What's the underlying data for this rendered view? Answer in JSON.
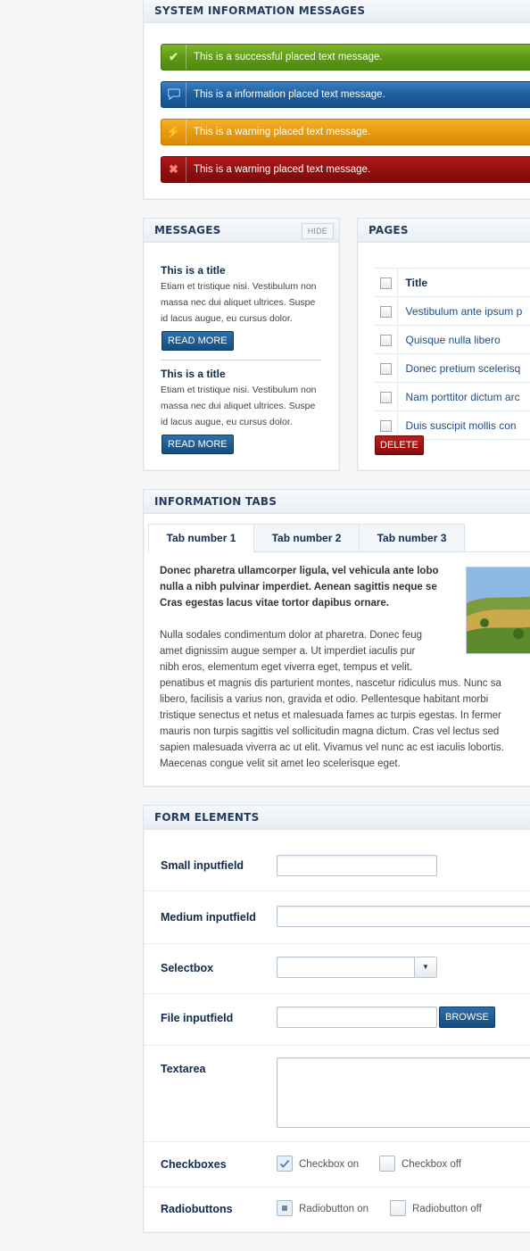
{
  "system_messages": {
    "title": "SYSTEM INFORMATION MESSAGES",
    "items": [
      {
        "type": "success",
        "icon": "check-icon",
        "text": "This is a successful placed text message."
      },
      {
        "type": "info",
        "icon": "speech-bubble-icon",
        "text": "This is a information placed text message."
      },
      {
        "type": "warning",
        "icon": "lightning-icon",
        "text": "This is a warning placed text message."
      },
      {
        "type": "error",
        "icon": "cross-icon",
        "text": "This is a warning placed text message."
      }
    ]
  },
  "messages": {
    "title": "MESSAGES",
    "hide_label": "HIDE",
    "articles": [
      {
        "title": "This is a title",
        "body": "Etiam et tristique nisi. Vestibulum non massa nec dui aliquet ultrices. Suspe id lacus augue, eu cursus dolor.",
        "button": "READ MORE"
      },
      {
        "title": "This is a title",
        "body": "Etiam et tristique nisi. Vestibulum non massa nec dui aliquet ultrices. Suspe id lacus augue, eu cursus dolor.",
        "button": "READ MORE"
      }
    ]
  },
  "pages": {
    "title": "PAGES",
    "column_header": "Title",
    "rows": [
      "Vestibulum ante ipsum p",
      "Quisque nulla libero",
      "Donec pretium scelerisq",
      "Nam porttitor dictum arc",
      "Duis suscipit mollis con"
    ],
    "delete_label": "DELETE"
  },
  "tabs": {
    "title": "INFORMATION TABS",
    "labels": [
      "Tab number 1",
      "Tab number 2",
      "Tab number 3"
    ],
    "active_index": 0,
    "intro": "Donec pharetra ullamcorper ligula, vel vehicula ante lobo nulla a nibh pulvinar imperdiet. Aenean sagittis neque se Cras egestas lacus vitae tortor dapibus ornare.",
    "body_lines": [
      "Nulla sodales condimentum dolor at pharetra. Donec feug",
      "amet dignissim augue semper a. Ut imperdiet iaculis pur",
      "nibh eros, elementum eget viverra eget, tempus et velit.",
      "penatibus et magnis dis parturient montes, nascetur ridiculus mus. Nunc sa",
      "libero, facilisis a varius non, gravida et odio. Pellentesque habitant morbi",
      "tristique senectus et netus et malesuada fames ac turpis egestas. In fermer",
      "mauris non turpis sagittis vel sollicitudin magna dictum. Cras vel lectus sed",
      "sapien malesuada viverra ac ut elit. Vivamus vel nunc ac est iaculis lobortis.",
      "Maecenas congue velit sit amet leo scelerisque eget."
    ]
  },
  "form": {
    "title": "FORM ELEMENTS",
    "small_label": "Small inputfield",
    "medium_label": "Medium inputfield",
    "select_label": "Selectbox",
    "file_label": "File inputfield",
    "browse_label": "BROWSE",
    "textarea_label": "Textarea",
    "checkboxes_label": "Checkboxes",
    "checkbox_on": "Checkbox on",
    "checkbox_off": "Checkbox off",
    "radios_label": "Radiobuttons",
    "radio_on": "Radiobutton on",
    "radio_off": "Radiobutton off"
  }
}
